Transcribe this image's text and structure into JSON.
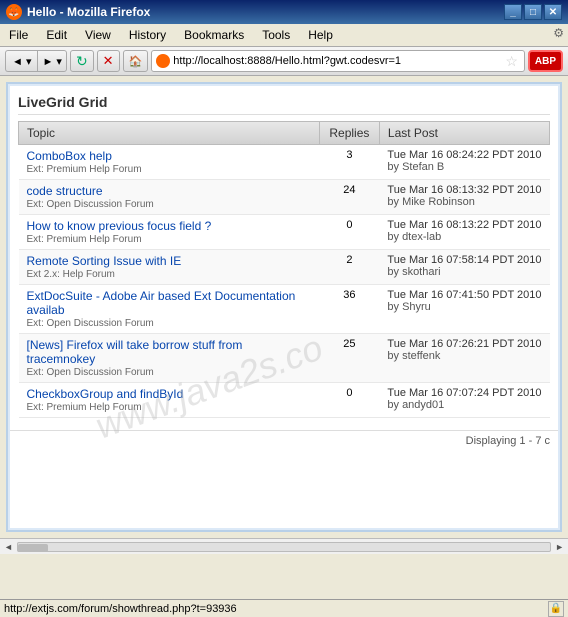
{
  "window": {
    "title": "Hello - Mozilla Firefox",
    "icon": "🦊"
  },
  "menubar": {
    "items": [
      "File",
      "Edit",
      "View",
      "History",
      "Bookmarks",
      "Tools",
      "Help"
    ]
  },
  "toolbar": {
    "back_label": "◄",
    "forward_label": "►",
    "reload_label": "↻",
    "stop_label": "✕",
    "home_label": "🏠",
    "url": "http://localhost:8888/Hello.html?gwt.codesvr=1",
    "star_label": "☆",
    "abp_label": "ABP"
  },
  "grid": {
    "title": "LiveGrid Grid",
    "columns": [
      "Topic",
      "Replies",
      "Last Post"
    ],
    "rows": [
      {
        "topic": "ComboBox help",
        "forum": "Ext: Premium Help Forum",
        "replies": "3",
        "last_post_date": "Tue Mar 16 08:24:22 PDT 2010",
        "last_post_by": "by Stefan B"
      },
      {
        "topic": "code structure",
        "forum": "Ext: Open Discussion Forum",
        "replies": "24",
        "last_post_date": "Tue Mar 16 08:13:32 PDT 2010",
        "last_post_by": "by Mike Robinson"
      },
      {
        "topic": "How to know previous focus field ?",
        "forum": "Ext: Premium Help Forum",
        "replies": "0",
        "last_post_date": "Tue Mar 16 08:13:22 PDT 2010",
        "last_post_by": "by dtex-lab"
      },
      {
        "topic": "Remote Sorting Issue with IE",
        "forum": "Ext 2.x: Help Forum",
        "replies": "2",
        "last_post_date": "Tue Mar 16 07:58:14 PDT 2010",
        "last_post_by": "by skothari"
      },
      {
        "topic": "ExtDocSuite - Adobe Air based Ext Documentation availab",
        "forum": "Ext: Open Discussion Forum",
        "replies": "36",
        "last_post_date": "Tue Mar 16 07:41:50 PDT 2010",
        "last_post_by": "by Shyru"
      },
      {
        "topic": "[News] Firefox will take borrow stuff from tracemnokey",
        "forum": "Ext: Open Discussion Forum",
        "replies": "25",
        "last_post_date": "Tue Mar 16 07:26:21 PDT 2010",
        "last_post_by": "by steffenk"
      },
      {
        "topic": "CheckboxGroup and findById",
        "forum": "Ext: Premium Help Forum",
        "replies": "0",
        "last_post_date": "Tue Mar 16 07:07:24 PDT 2010",
        "last_post_by": "by andyd01"
      }
    ],
    "footer": "Displaying 1 - 7 c",
    "watermark": "www.java2s.co"
  },
  "statusbar": {
    "url": "http://extjs.com/forum/showthread.php?t=93936"
  }
}
